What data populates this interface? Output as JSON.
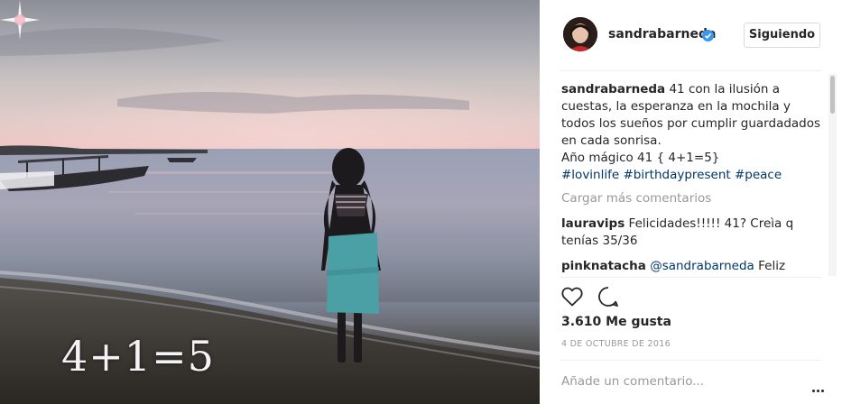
{
  "photo": {
    "overlay_text": "4+1=5",
    "description_icon": "photo"
  },
  "header": {
    "username": "sandrabarneda",
    "verified_icon": "verified-badge-icon",
    "follow_label": "Siguiendo"
  },
  "caption": {
    "username": "sandrabarneda",
    "text": "41 con la ilusión a cuestas, la esperanza en la mochila y todos los sueños por cumplir guardadados en cada sonrisa.\nAño mágico 41 { 4+1=5}",
    "hashtags": [
      "#lovinlife",
      "#birthdaypresent",
      "#peace"
    ]
  },
  "load_more_label": "Cargar más comentarios",
  "comments": [
    {
      "username": "lauravips",
      "mention": "",
      "text": "Felicidades!!!!! 41? Creìa q tenías 35/36"
    },
    {
      "username": "pinknatacha",
      "mention": "@sandrabarneda",
      "text": "Feliz cumpleaños a la personita especial que"
    }
  ],
  "actions": {
    "like_icon": "heart-icon",
    "comment_icon": "comment-bubble-icon",
    "likes_text": "3.610 Me gusta",
    "date_text": "4 DE OCTUBRE DE 2016"
  },
  "add_comment": {
    "placeholder": "Añade un comentario...",
    "more_icon": "more-options-icon"
  },
  "colors": {
    "hashtag": "#003569",
    "muted": "#999999",
    "verified": "#3897f0",
    "border": "#efefef"
  }
}
